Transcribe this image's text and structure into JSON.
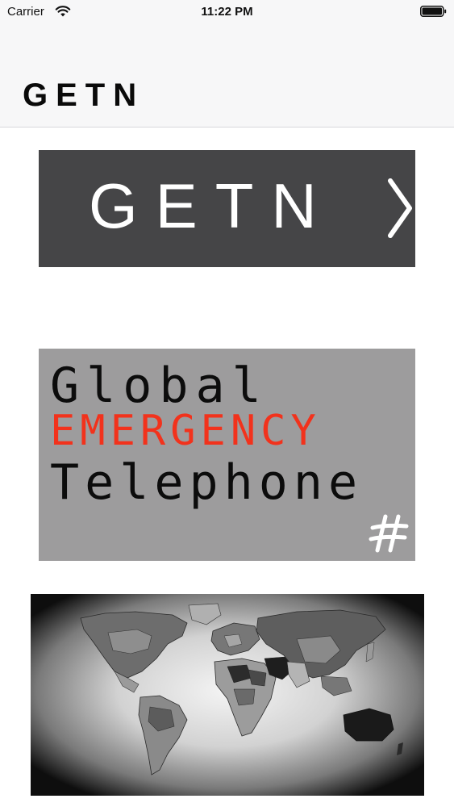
{
  "status_bar": {
    "carrier": "Carrier",
    "time": "11:22 PM",
    "icons": [
      "wifi-icon",
      "battery-icon"
    ]
  },
  "nav": {
    "title": "GETN"
  },
  "banners": {
    "getn": {
      "text": "GETN",
      "icon": "chevron-right-icon"
    },
    "global": {
      "line1": "Global",
      "line2": "EMERGENCY",
      "line3": "Telephone",
      "icon": "hash-icon"
    },
    "map": {
      "icon": "world-map-icon"
    }
  },
  "colors": {
    "bar_background": "#f7f7f8",
    "getn_banner": "#454547",
    "global_banner": "#9d9c9d",
    "emergency_red": "#f2321c"
  }
}
